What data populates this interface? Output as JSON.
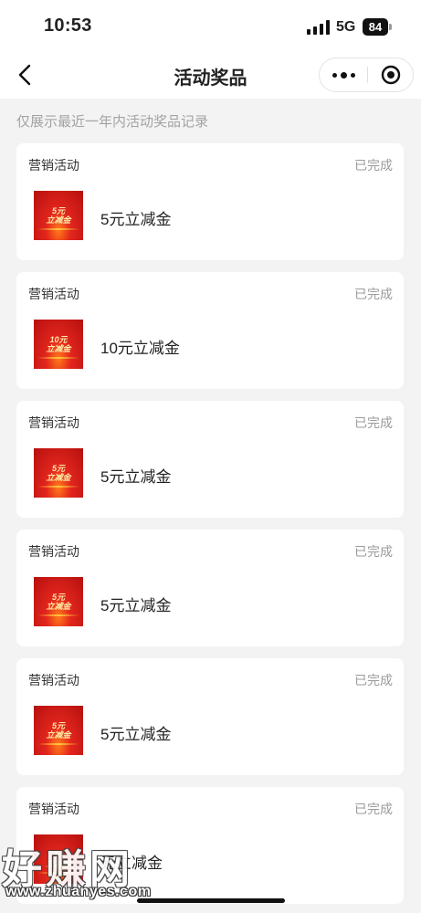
{
  "status_bar": {
    "time": "10:53",
    "network": "5G",
    "battery": "84"
  },
  "nav": {
    "title": "活动奖品",
    "back_icon": "chevron-left-icon",
    "more_icon": "more-dots-icon",
    "close_icon": "target-close-icon"
  },
  "notice": "仅展示最近一年内活动奖品记录",
  "records": [
    {
      "category": "营销活动",
      "status": "已完成",
      "thumb_line1": "5元",
      "thumb_line2": "立减金",
      "prize": "5元立减金"
    },
    {
      "category": "营销活动",
      "status": "已完成",
      "thumb_line1": "10元",
      "thumb_line2": "立减金",
      "prize": "10元立减金"
    },
    {
      "category": "营销活动",
      "status": "已完成",
      "thumb_line1": "5元",
      "thumb_line2": "立减金",
      "prize": "5元立减金"
    },
    {
      "category": "营销活动",
      "status": "已完成",
      "thumb_line1": "5元",
      "thumb_line2": "立减金",
      "prize": "5元立减金"
    },
    {
      "category": "营销活动",
      "status": "已完成",
      "thumb_line1": "5元",
      "thumb_line2": "立减金",
      "prize": "5元立减金"
    },
    {
      "category": "营销活动",
      "status": "已完成",
      "thumb_line1": "10",
      "thumb_line2": "立减金",
      "prize": "元立减金"
    }
  ],
  "watermark": {
    "main": "好赚网",
    "url": "www.zhuanyes.com"
  },
  "colors": {
    "thumb_red": "#d81e1a",
    "thumb_gold": "#ffe9a8",
    "muted_text": "#9b9b9b",
    "page_bg": "#f3f3f3"
  }
}
